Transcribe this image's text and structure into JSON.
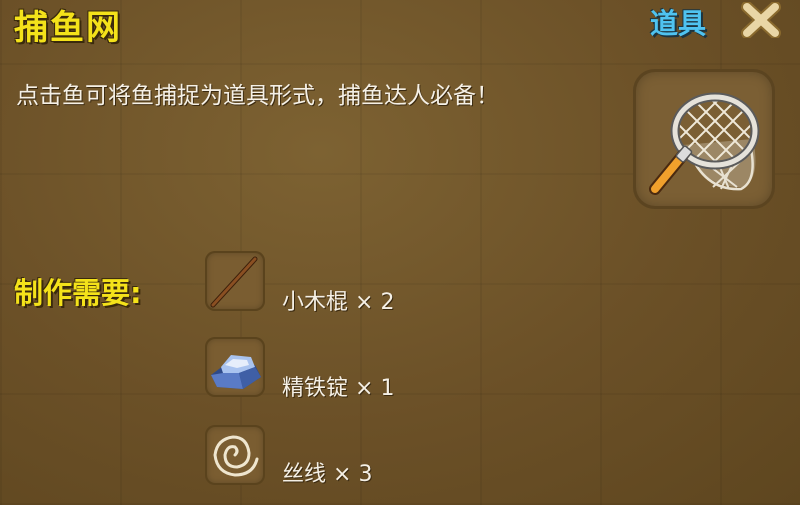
{
  "item": {
    "title": "捕鱼网",
    "category": "道具",
    "description": "点击鱼可将鱼捕捉为道具形式，捕鱼达人必备！",
    "icon": "fishing-net-icon"
  },
  "recipe": {
    "label": "制作需要:",
    "ingredients": [
      {
        "name": "小木棍",
        "qty": "× 2",
        "icon": "wooden-stick-icon"
      },
      {
        "name": "精铁锭",
        "qty": "× 1",
        "icon": "iron-ingot-icon"
      },
      {
        "name": "丝线",
        "qty": "× 3",
        "icon": "silk-thread-icon"
      }
    ]
  },
  "colors": {
    "title": "#f4e21a",
    "category": "#4fc3f0",
    "panel": "#6e5429",
    "text": "#f5f0e6"
  }
}
